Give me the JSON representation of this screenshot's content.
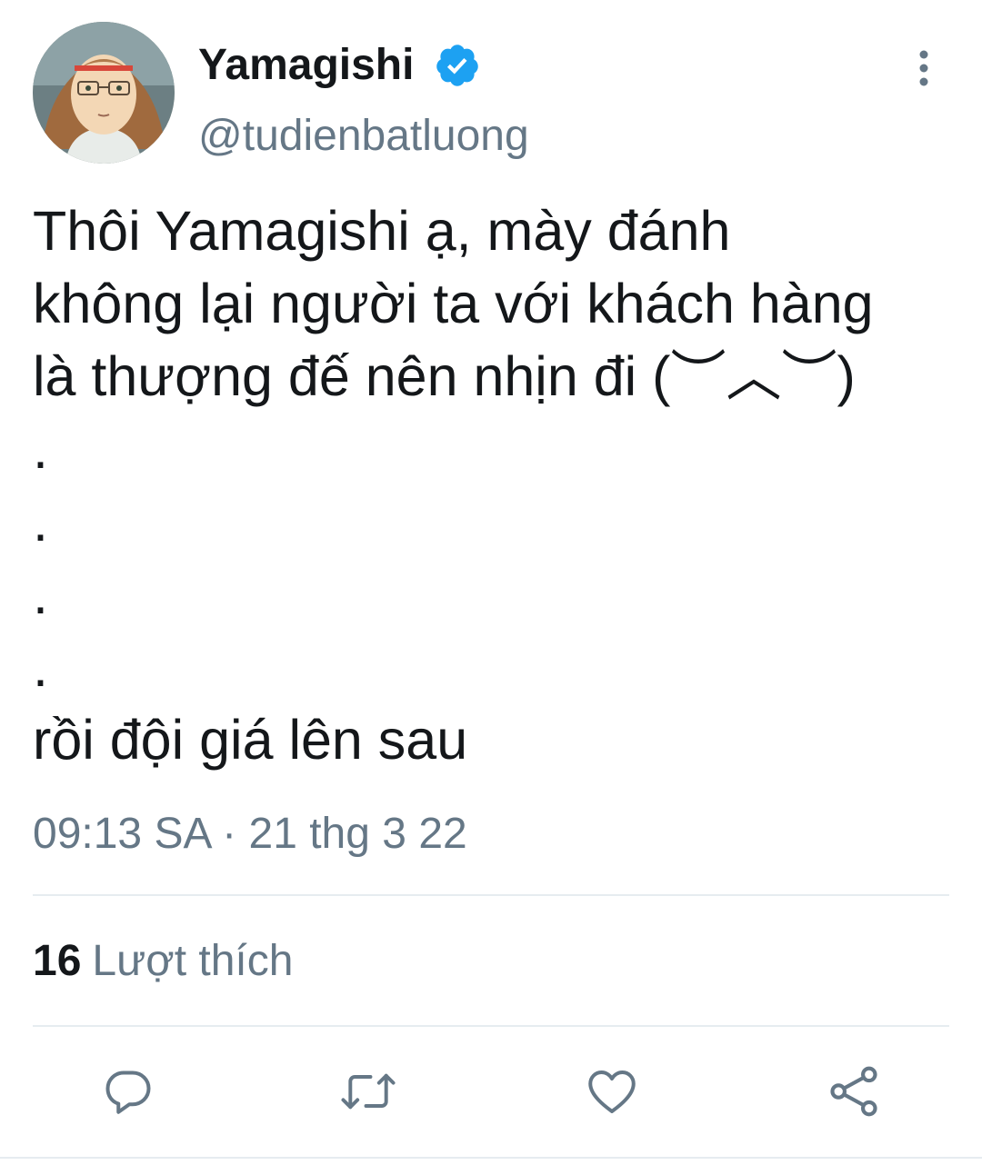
{
  "author": {
    "display_name": "Yamagishi",
    "handle": "@tudienbatluong",
    "verified": true,
    "avatar_icon": "anime-character-avatar"
  },
  "tweet": {
    "text": "Thôi Yamagishi ạ, mày đánh\nkhông lại người ta với khách hàng\nlà thượng đế nên nhịn đi (︶︿︶)\n.\n.\n.\n.\nrồi đội giá lên sau",
    "timestamp": "09:13 SA · 21 thg 3 22"
  },
  "stats": {
    "likes_count": "16",
    "likes_label": "Lượt thích"
  },
  "actions": [
    {
      "icon": "reply-icon"
    },
    {
      "icon": "retweet-icon"
    },
    {
      "icon": "like-icon"
    },
    {
      "icon": "share-icon"
    }
  ],
  "colors": {
    "text": "#14171a",
    "secondary": "#657786",
    "verified": "#1da1f2",
    "divider": "#e6ecf0"
  }
}
